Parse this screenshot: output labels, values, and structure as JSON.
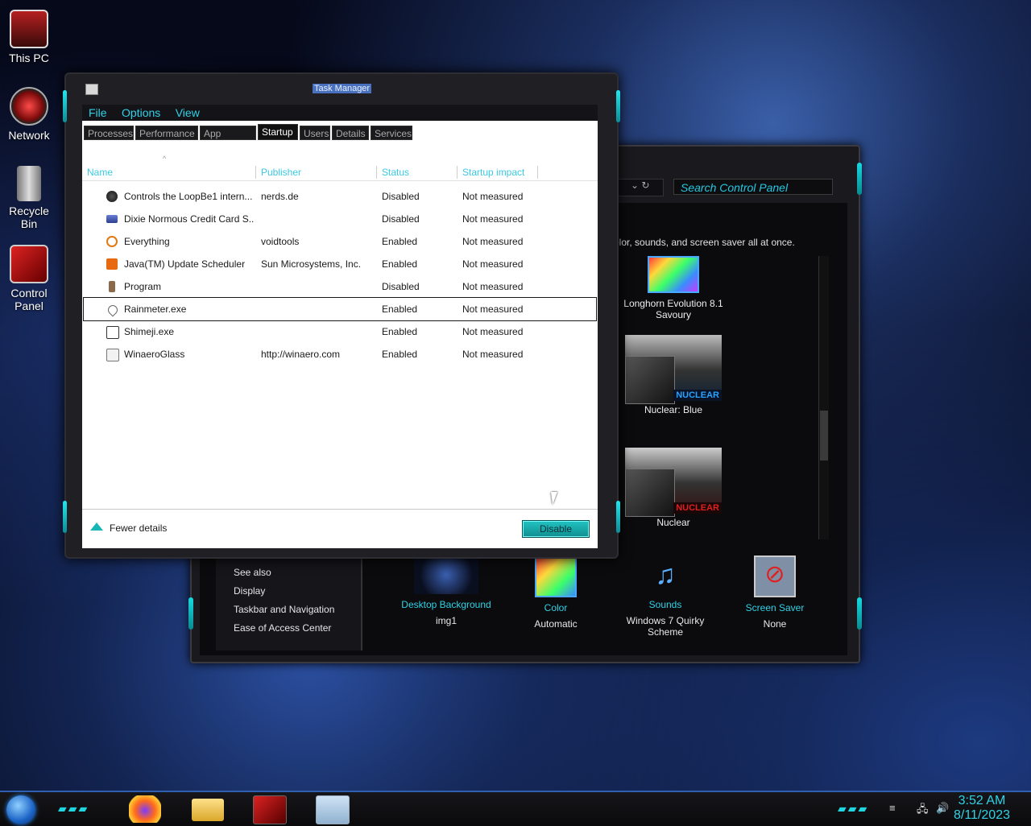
{
  "desktop": {
    "icons": [
      {
        "label": "This PC"
      },
      {
        "label": "Network"
      },
      {
        "label": "Recycle Bin"
      },
      {
        "label": "Control Panel"
      }
    ]
  },
  "control_panel": {
    "search_placeholder": "Search Control Panel",
    "description": "olor, sounds, and screen saver all at once.",
    "themes": [
      {
        "name": "Longhorn Evolution 8.1 Savoury"
      },
      {
        "name": "Nuclear: Blue",
        "badge": "NUCLEAR"
      },
      {
        "name": "Nuclear",
        "badge": "NUCLEAR"
      }
    ],
    "see_also": {
      "heading": "See also",
      "links": [
        "Display",
        "Taskbar and Navigation",
        "Ease of Access Center"
      ]
    },
    "bottom": [
      {
        "title": "Desktop Background",
        "value": "img1"
      },
      {
        "title": "Color",
        "value": "Automatic"
      },
      {
        "title": "Sounds",
        "value": "Windows 7 Quirky Scheme"
      },
      {
        "title": "Screen Saver",
        "value": "None"
      }
    ]
  },
  "task_manager": {
    "title": "Task Manager",
    "menu": [
      "File",
      "Options",
      "View"
    ],
    "tabs": [
      "Processes",
      "Performance",
      "App history",
      "Startup",
      "Users",
      "Details",
      "Services"
    ],
    "active_tab": "Startup",
    "columns": [
      "Name",
      "Publisher",
      "Status",
      "Startup impact"
    ],
    "rows": [
      {
        "name": "Controls the LoopBe1 intern...",
        "publisher": "nerds.de",
        "status": "Disabled",
        "impact": "Not measured",
        "icon": "loopbe-icon"
      },
      {
        "name": "Dixie Normous Credit Card S...",
        "publisher": "",
        "status": "Disabled",
        "impact": "Not measured",
        "icon": "card-icon"
      },
      {
        "name": "Everything",
        "publisher": "voidtools",
        "status": "Enabled",
        "impact": "Not measured",
        "icon": "magnifier-icon"
      },
      {
        "name": "Java(TM) Update Scheduler",
        "publisher": "Sun Microsystems, Inc.",
        "status": "Enabled",
        "impact": "Not measured",
        "icon": "java-icon"
      },
      {
        "name": "Program",
        "publisher": "",
        "status": "Disabled",
        "impact": "Not measured",
        "icon": "program-icon"
      },
      {
        "name": "Rainmeter.exe",
        "publisher": "",
        "status": "Enabled",
        "impact": "Not measured",
        "icon": "rainmeter-icon"
      },
      {
        "name": "Shimeji.exe",
        "publisher": "",
        "status": "Enabled",
        "impact": "Not measured",
        "icon": "shimeji-icon"
      },
      {
        "name": "WinaeroGlass",
        "publisher": "http://winaero.com",
        "status": "Enabled",
        "impact": "Not measured",
        "icon": "winaero-icon"
      }
    ],
    "fewer_details": "Fewer details",
    "disable_button": "Disable"
  },
  "taskbar": {
    "time": "3:52 AM",
    "date": "8/11/2023"
  }
}
